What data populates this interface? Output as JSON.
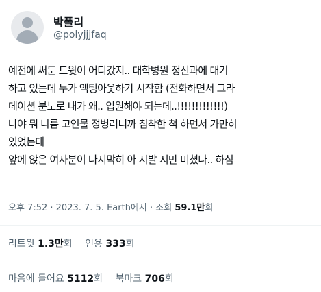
{
  "user": {
    "display_name": "박폴리",
    "handle": "@polyjjjfaq"
  },
  "tweet": {
    "lines": [
      "예전에 써둔 트윗이 어디갔지.. 대학병원 정신과에 대기",
      "하고 있는데 누가 액팅아웃하기 시작함 (전화하면서 그라",
      "데이션 분노로 내가 왜.. 입원해야 되는데..!!!!!!!!!!!!!)",
      "나야 뭐 나름 고인물 정병러니까 침착한 척 하면서 가만히",
      "있었는데",
      "앞에 앉은 여자분이 나지막히 아 시발 지만 미쳤나.. 하심"
    ]
  },
  "meta": {
    "time": "오후 7:52",
    "date": "2023. 7. 5.",
    "source": "Earth에서",
    "views_label": "조회",
    "views_count": "59.1만",
    "views_unit": "회"
  },
  "stats": {
    "retweets_label": "리트윗",
    "retweets_count": "1.3만",
    "retweets_unit": "회",
    "quotes_label": "인용",
    "quotes_count": "333",
    "quotes_unit": "회",
    "likes_label": "마음에 들어요",
    "likes_count": "5112",
    "likes_unit": "회",
    "bookmarks_label": "북마크",
    "bookmarks_count": "706",
    "bookmarks_unit": "회"
  }
}
